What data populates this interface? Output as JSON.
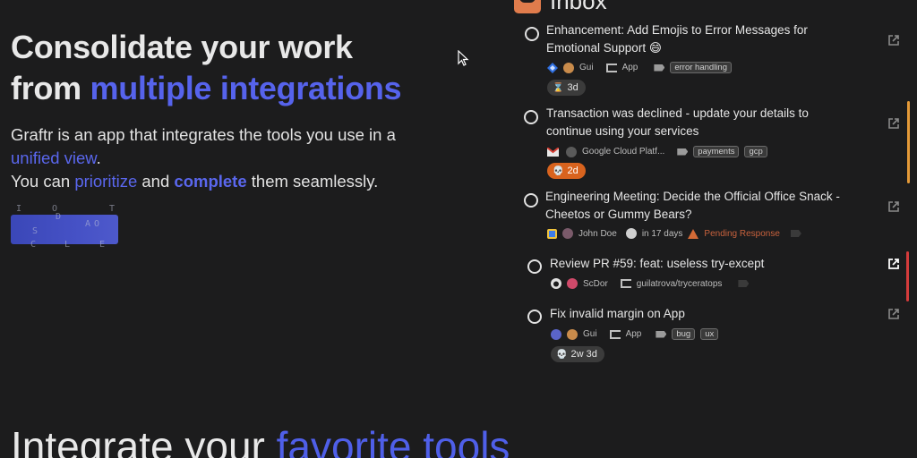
{
  "hero": {
    "line1": "Consolidate your work",
    "line2_plain": "from ",
    "line2_accent": "multiple integrations",
    "desc_1": "Graftr is an app that integrates the tools you use in a",
    "desc_link": "unified view",
    "desc_2": ".",
    "desc_3": "You can ",
    "prioritize": "prioritize",
    "and": " and ",
    "complete": "complete",
    "desc_4": " them seamlessly.",
    "scramble_letters": [
      "I",
      "O",
      "T",
      "D",
      "S",
      "A",
      "O",
      "C",
      "L",
      "E"
    ]
  },
  "section": {
    "title_plain": "Integrate your ",
    "title_accent": "favorite tools"
  },
  "inbox": {
    "title": "Inbox",
    "icon": "inbox-tray-icon",
    "tasks": [
      {
        "title": "Enhancement: Add Emojis to Error Messages for Emotional Support 😄",
        "source_icon": "jira-icon",
        "user": "Gui",
        "project": "App",
        "tags": [
          "error handling"
        ],
        "badge": "3d",
        "badge_icon": "hourglass-icon",
        "badge_style": "neutral"
      },
      {
        "title": "Transaction was declined - update your details to continue using your services",
        "source_icon": "gmail-icon",
        "user": "Google Cloud Platf...",
        "tags": [
          "payments",
          "gcp"
        ],
        "badge": "2d",
        "badge_icon": "skull-icon",
        "badge_style": "hot",
        "stripe_color": "#e49a38"
      },
      {
        "title": "Engineering Meeting: Decide the Official Office Snack - Cheetos or Gummy Bears?",
        "source_icon": "google-calendar-icon",
        "user": "John Doe",
        "due": "in 17 days",
        "status": "Pending Response"
      },
      {
        "title": "Review PR #59: feat: useless try-except",
        "source_icon": "github-icon",
        "user": "ScDor",
        "project": "guilatrova/tryceratops",
        "stripe_color": "#d43b3b"
      },
      {
        "title": "Fix invalid margin on App",
        "source_icon": "linear-icon",
        "user": "Gui",
        "project": "App",
        "tags": [
          "bug",
          "ux"
        ],
        "badge": "2w 3d",
        "badge_icon": "skull-icon",
        "badge_style": "neutral"
      }
    ]
  },
  "colors": {
    "accent": "#5663ec",
    "background": "#1c1c1d",
    "hot": "#d8631e"
  }
}
